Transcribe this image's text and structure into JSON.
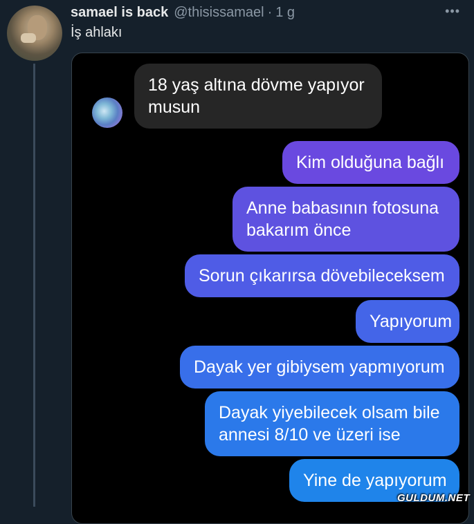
{
  "tweet": {
    "display_name": "samael is back",
    "handle": "@thisissamael",
    "separator": "·",
    "time": "1 g",
    "more_icon": "more-horizontal-icon",
    "text": "İş ahlakı"
  },
  "chat": {
    "received": [
      {
        "text_line1": "18 yaş altına dövme yapıyor",
        "text_line2": "musun"
      }
    ],
    "sent": [
      {
        "line1": "Kim olduğuna bağlı"
      },
      {
        "line1": "Anne babasının fotosuna",
        "line2": "bakarım önce"
      },
      {
        "line1": "Sorun çıkarırsa dövebileceksem"
      },
      {
        "line1": "Yapıyorum"
      },
      {
        "line1": "Dayak yer gibiysem yapmıyorum"
      },
      {
        "line1": "Dayak yiyebilecek olsam bile",
        "line2": "annesi 8/10 ve üzeri ise"
      },
      {
        "line1": "Yine de yapıyorum"
      }
    ]
  },
  "watermark": "GULDUM.NET",
  "colors": {
    "background": "#15202b",
    "received_bubble": "#262626",
    "sent_gradient_top": "#7b3ee0",
    "sent_gradient_bottom": "#1e88e8"
  }
}
